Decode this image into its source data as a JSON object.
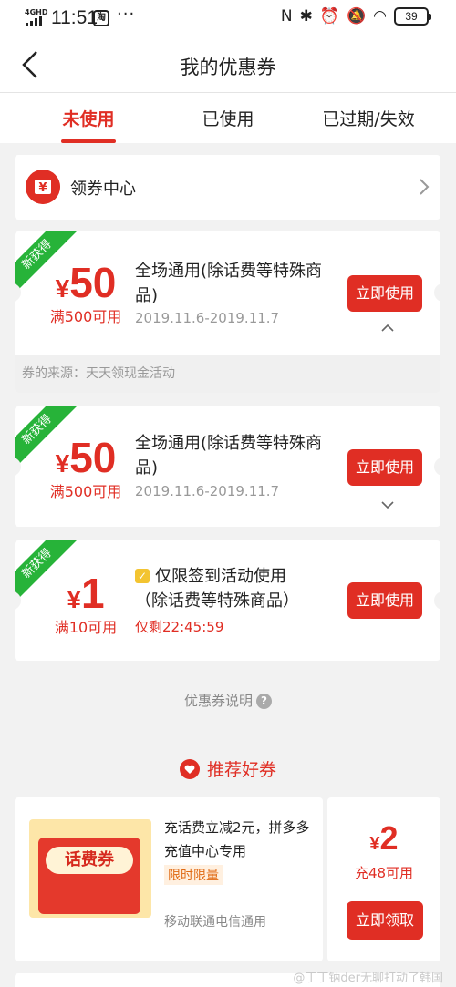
{
  "status_bar": {
    "network": "4GHD",
    "time": "11:51",
    "app_icon_text": "淘",
    "dots": "···",
    "battery": "39"
  },
  "nav": {
    "title": "我的优惠券",
    "back_icon": "chevron-left-icon"
  },
  "tabs": [
    {
      "label": "未使用",
      "active": true
    },
    {
      "label": "已使用",
      "active": false
    },
    {
      "label": "已过期/失效",
      "active": false
    }
  ],
  "coupon_center": {
    "label": "领券中心",
    "icon": "coupon-center-icon"
  },
  "coupons": [
    {
      "ribbon": "新获得",
      "currency": "¥",
      "amount": "50",
      "condition": "满500可用",
      "description": "全场通用(除话费等特殊商品)",
      "dates": "2019.11.6-2019.11.7",
      "button": "立即使用",
      "expanded": true,
      "source": "券的来源：天天领现金活动"
    },
    {
      "ribbon": "新获得",
      "currency": "¥",
      "amount": "50",
      "condition": "满500可用",
      "description": "全场通用(除话费等特殊商品)",
      "dates": "2019.11.6-2019.11.7",
      "button": "立即使用",
      "expanded": false
    },
    {
      "ribbon": "新获得",
      "currency": "¥",
      "amount": "1",
      "condition": "满10可用",
      "description_line1": "仅限签到活动使用",
      "description_line2": "（除话费等特殊商品）",
      "timer": "仅剩22:45:59",
      "button": "立即使用"
    }
  ],
  "coupon_explain": {
    "label": "优惠券说明",
    "icon": "?"
  },
  "recommend": {
    "header": "推荐好券",
    "item": {
      "thumb_label": "话费券",
      "description": "充话费立减2元，拼多多充值中心专用",
      "badge": "限时限量",
      "tag": "移动联通电信通用",
      "currency": "¥",
      "amount": "2",
      "condition": "充48可用",
      "button": "立即领取"
    }
  },
  "watermark": "@丁丁钠der无聊打动了韩国",
  "colors": {
    "accent": "#e02e24",
    "ribbon": "#27b339",
    "background": "#f2f2f2"
  }
}
